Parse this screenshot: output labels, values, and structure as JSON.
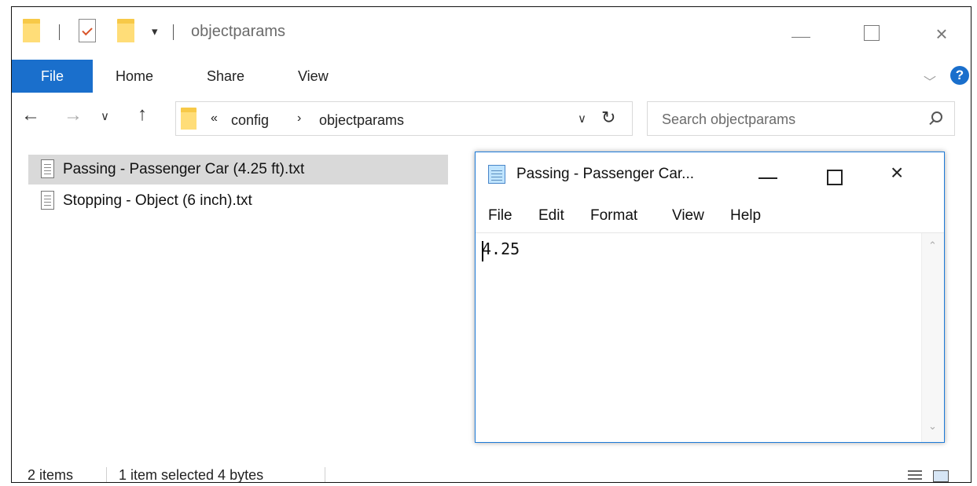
{
  "explorer": {
    "title": "objectparams",
    "quick_access_dropdown": "▾",
    "window_controls": {
      "minimize": "minimize",
      "maximize": "maximize",
      "close": "×"
    },
    "ribbon": {
      "file_label": "File",
      "tabs": [
        "Home",
        "Share",
        "View"
      ],
      "expand_glyph": "﹀",
      "help_glyph": "?"
    },
    "address": {
      "overflow_glyph": "«",
      "crumbs": [
        "config",
        "objectparams"
      ],
      "separator_glyph": "›",
      "dropdown_glyph": "∨",
      "refresh_glyph": "↻"
    },
    "search": {
      "placeholder": "Search objectparams"
    },
    "files": [
      {
        "name": "Passing - Passenger Car (4.25 ft).txt",
        "selected": true
      },
      {
        "name": "Stopping - Object (6 inch).txt",
        "selected": false
      }
    ],
    "status": {
      "item_count": "2 items",
      "selection": "1 item selected  4 bytes"
    }
  },
  "notepad": {
    "title": "Passing - Passenger Car...",
    "close_glyph": "×",
    "menu": [
      "File",
      "Edit",
      "Format",
      "View",
      "Help"
    ],
    "content": "4.25",
    "scroll_up_glyph": "⌃",
    "scroll_down_glyph": "⌄"
  },
  "colors": {
    "accent": "#1a6fcc",
    "selection": "#d9d9d9",
    "folder": "#ffdd78",
    "notepad_border": "#1c7ad8"
  },
  "icons": [
    "folder-icon",
    "properties-icon",
    "back-arrow-icon",
    "forward-arrow-icon",
    "up-arrow-icon",
    "refresh-icon",
    "search-icon",
    "text-file-icon",
    "notepad-icon",
    "details-view-icon",
    "tiles-view-icon",
    "help-icon"
  ]
}
